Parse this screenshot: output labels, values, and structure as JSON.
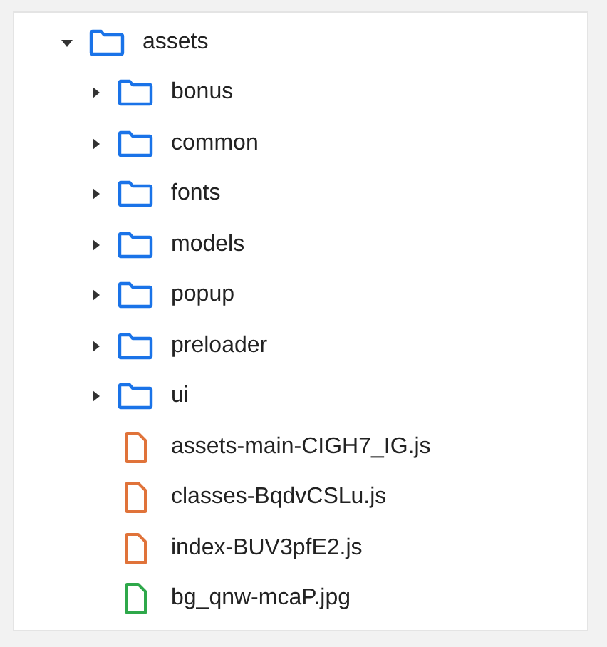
{
  "tree": [
    {
      "kind": "folder",
      "name": "assets",
      "expanded": true,
      "children": [
        {
          "kind": "folder",
          "name": "bonus",
          "expanded": false
        },
        {
          "kind": "folder",
          "name": "common",
          "expanded": false
        },
        {
          "kind": "folder",
          "name": "fonts",
          "expanded": false
        },
        {
          "kind": "folder",
          "name": "models",
          "expanded": false
        },
        {
          "kind": "folder",
          "name": "popup",
          "expanded": false
        },
        {
          "kind": "folder",
          "name": "preloader",
          "expanded": false
        },
        {
          "kind": "folder",
          "name": "ui",
          "expanded": false
        },
        {
          "kind": "file",
          "name": "assets-main-CIGH7_IG.js",
          "color": "#e0733a"
        },
        {
          "kind": "file",
          "name": "classes-BqdvCSLu.js",
          "color": "#e0733a"
        },
        {
          "kind": "file",
          "name": "index-BUV3pfE2.js",
          "color": "#e0733a"
        },
        {
          "kind": "file",
          "name": "bg_qnw-mcaP.jpg",
          "color": "#2ea84a"
        }
      ]
    }
  ]
}
